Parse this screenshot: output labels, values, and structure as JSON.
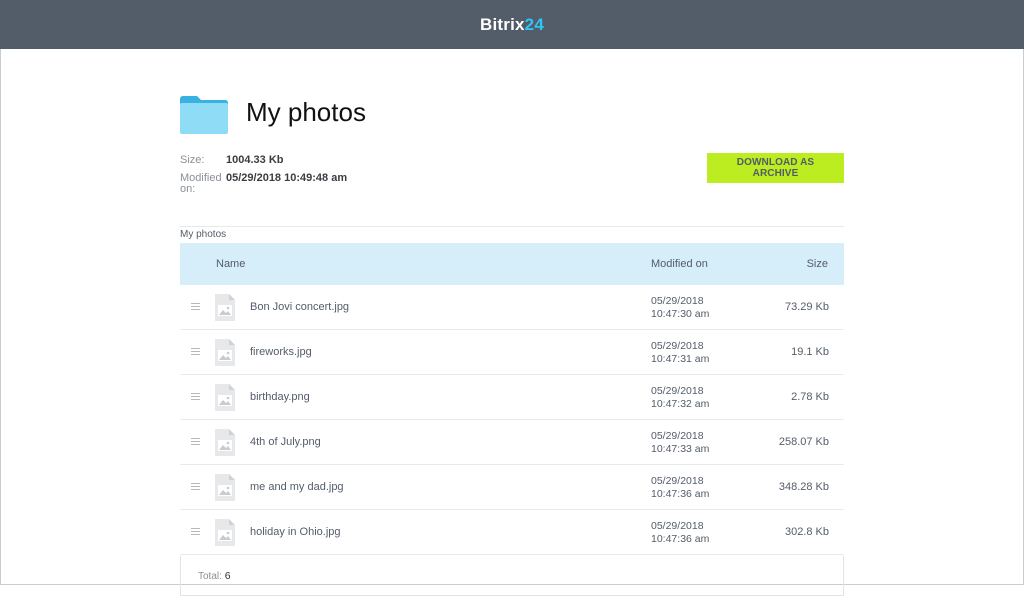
{
  "app": {
    "logo_text": "Bitrix",
    "logo_num": "24",
    "header_bg": "#535c69",
    "accent": "#2fc6f6"
  },
  "folder": {
    "icon": "folder-icon",
    "title": "My photos",
    "size_label": "Size:",
    "size_value": "1004.33 Kb",
    "modified_label_1": "Modified",
    "modified_label_2": "on:",
    "modified_value": "05/29/2018 10:49:48 am"
  },
  "actions": {
    "download_label": "DOWNLOAD AS ARCHIVE",
    "download_color": "#bbed21"
  },
  "breadcrumb": "My photos",
  "table": {
    "headers": {
      "name": "Name",
      "modified": "Modified on",
      "size": "Size"
    },
    "header_bg": "#d5eef9",
    "rows": [
      {
        "name": "Bon Jovi concert.jpg",
        "date": "05/29/2018",
        "time": "10:47:30 am",
        "size": "73.29 Kb",
        "icon": "image-file-icon"
      },
      {
        "name": "fireworks.jpg",
        "date": "05/29/2018",
        "time": "10:47:31 am",
        "size": "19.1 Kb",
        "icon": "image-file-icon"
      },
      {
        "name": "birthday.png",
        "date": "05/29/2018",
        "time": "10:47:32 am",
        "size": "2.78 Kb",
        "icon": "image-file-icon"
      },
      {
        "name": "4th of July.png",
        "date": "05/29/2018",
        "time": "10:47:33 am",
        "size": "258.07 Kb",
        "icon": "image-file-icon"
      },
      {
        "name": "me and my dad.jpg",
        "date": "05/29/2018",
        "time": "10:47:36 am",
        "size": "348.28 Kb",
        "icon": "image-file-icon"
      },
      {
        "name": "holiday in Ohio.jpg",
        "date": "05/29/2018",
        "time": "10:47:36 am",
        "size": "302.8 Kb",
        "icon": "image-file-icon"
      }
    ],
    "total_label": "Total:",
    "total_value": "6"
  }
}
